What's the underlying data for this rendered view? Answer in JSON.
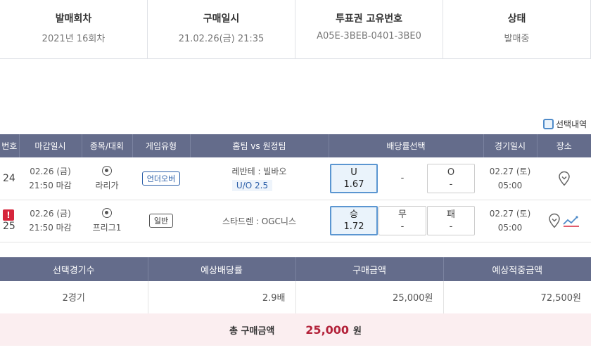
{
  "ticket": {
    "cols": [
      {
        "head": "발매회차",
        "value": "2021년 16회차"
      },
      {
        "head": "구매일시",
        "value": "21.02.26(금) 21:35"
      },
      {
        "head": "투표권 고유번호",
        "value": "A05E-3BEB-0401-3BE0"
      },
      {
        "head": "상태",
        "value": "발매중"
      }
    ]
  },
  "legend": {
    "select_label": "선택내역"
  },
  "games": {
    "headers": [
      "번호",
      "마감일시",
      "종목/대회",
      "게임유형",
      "홈팀 vs 원정팀",
      "배당률선택",
      "경기일시",
      "장소"
    ],
    "rows": [
      {
        "no": "24",
        "alert": "",
        "close_date": "02.26 (금)",
        "close_time": "21:50 마감",
        "sport_icon": "soccer-ball-icon",
        "league": "라리가",
        "type": "언더오버",
        "match": "레반테 : 빌바오",
        "sub": "U/O 2.5",
        "odds": [
          {
            "label": "U",
            "value": "1.67",
            "selected": true
          },
          {
            "label": "-",
            "value": "",
            "selected": false
          },
          {
            "label": "O",
            "value": "-",
            "selected": false
          }
        ],
        "game_date": "02.27 (토)",
        "game_time": "05:00"
      },
      {
        "no": "25",
        "alert": "!",
        "close_date": "02.26 (금)",
        "close_time": "21:50 마감",
        "sport_icon": "soccer-ball-icon",
        "league": "프리그1",
        "type": "일반",
        "match": "스타드렌 : OGC니스",
        "sub": "",
        "odds": [
          {
            "label": "승",
            "value": "1.72",
            "selected": true
          },
          {
            "label": "무",
            "value": "-",
            "selected": false
          },
          {
            "label": "패",
            "value": "-",
            "selected": false
          }
        ],
        "game_date": "02.27 (토)",
        "game_time": "05:00"
      }
    ]
  },
  "summary": {
    "headers": [
      "선택경기수",
      "예상배당률",
      "구매금액",
      "예상적중금액"
    ],
    "values": [
      "2경기",
      "2.9배",
      "25,000원",
      "72,500원"
    ]
  },
  "total": {
    "label": "총 구매금액",
    "amount": "25,000",
    "unit": "원"
  },
  "colors": {
    "header_bg": "#646c8b",
    "selected_border": "#5b96d1",
    "total_amount": "#b3223a",
    "alert": "#d6263c"
  }
}
